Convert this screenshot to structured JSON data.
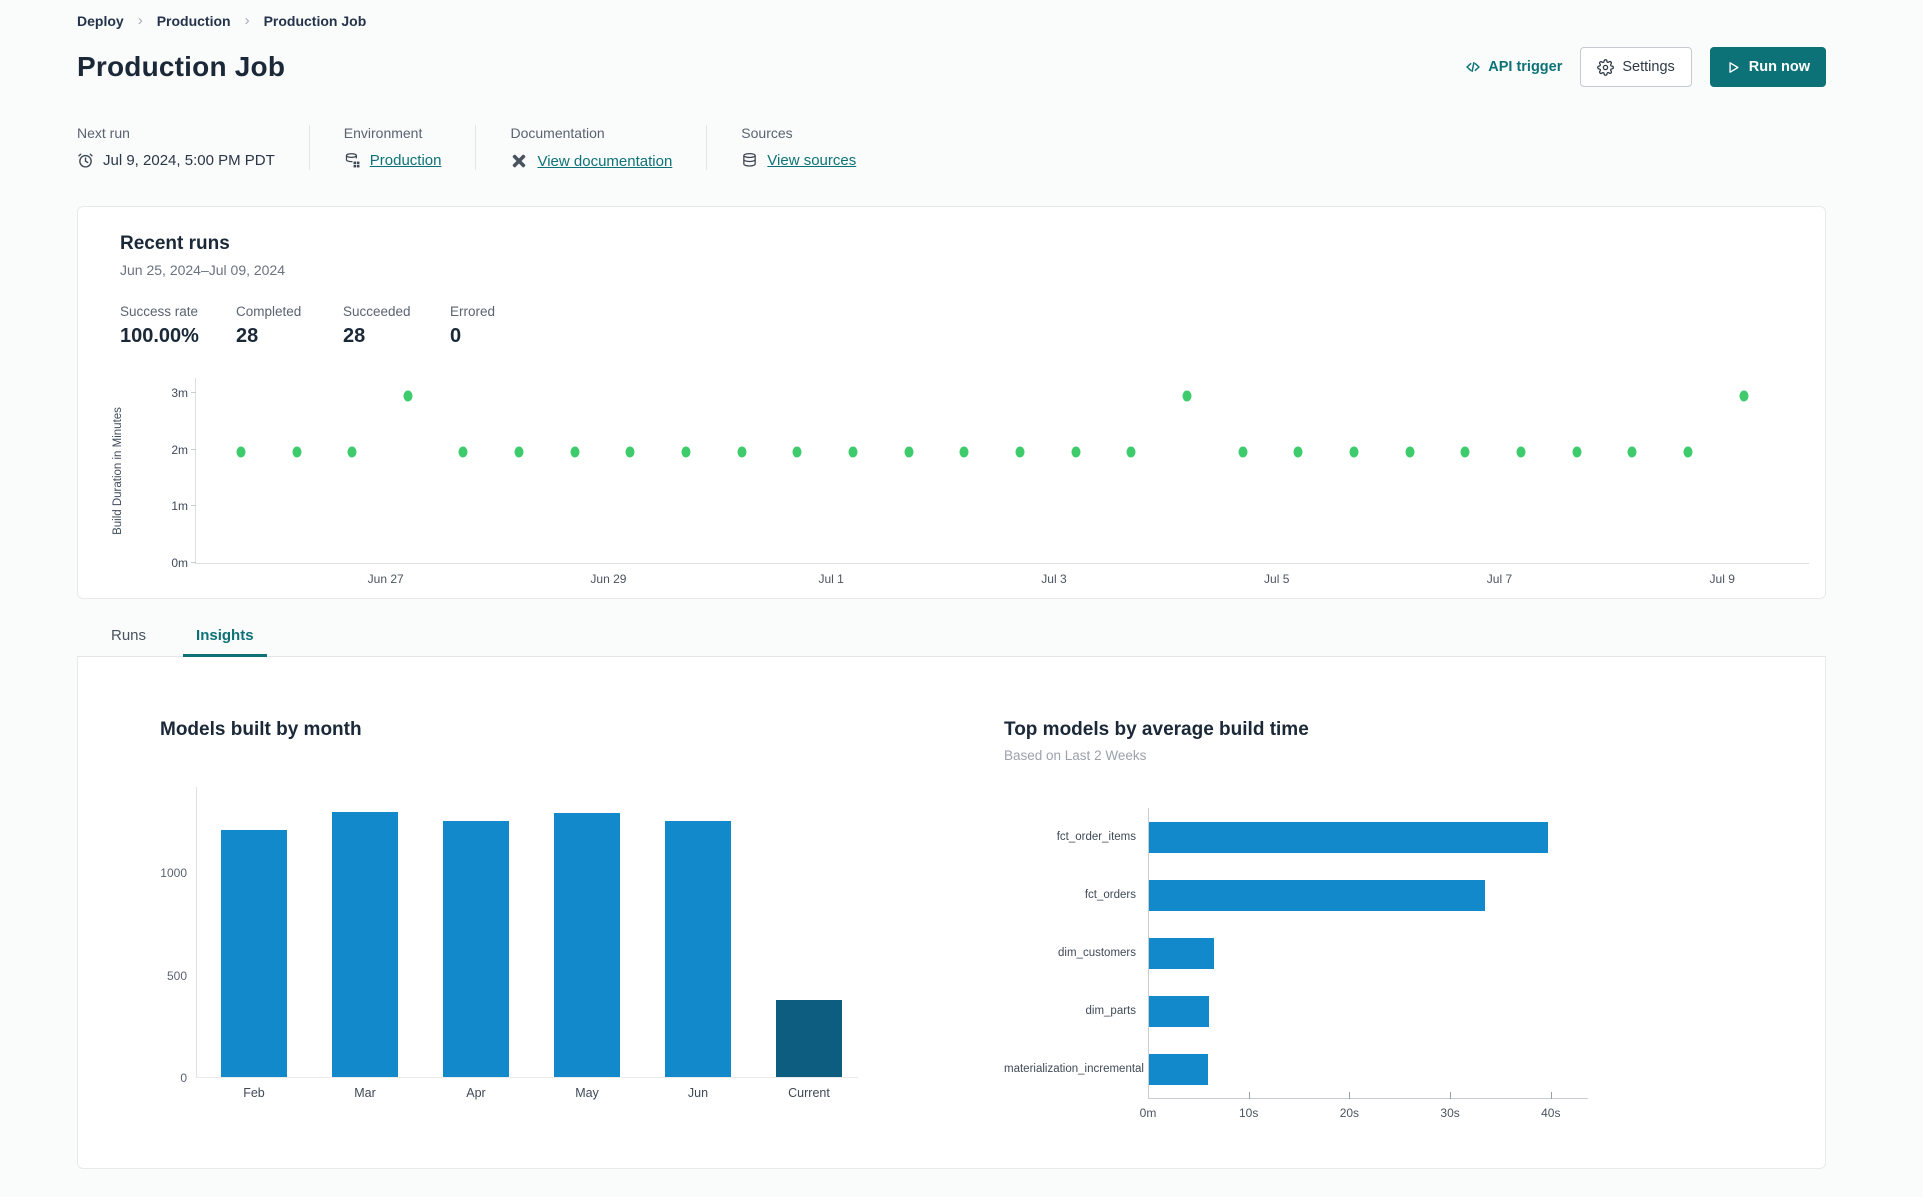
{
  "colors": {
    "accent_teal": "#0d7277",
    "success_green": "#3dcb6c",
    "bar_blue": "#1289ca",
    "bar_dark_navy": "#0c5d80",
    "page_background": "#fafbfb",
    "card_border": "#e7e9eb",
    "dark_text": "#1a2838"
  },
  "icons": {
    "breadcrumb_separator": "chevron-right-icon",
    "api_trigger": "code-icon",
    "settings": "gear-icon",
    "run_now": "play-icon",
    "next_run": "clock-icon",
    "environment": "environment-database-icon",
    "documentation": "dbt-docs-icon",
    "sources": "database-icon"
  },
  "breadcrumb": {
    "items": [
      "Deploy",
      "Production",
      "Production Job"
    ]
  },
  "header": {
    "title": "Production Job",
    "api_trigger_label": "API trigger",
    "settings_label": "Settings",
    "run_now_label": "Run now"
  },
  "meta": {
    "columns": [
      {
        "label": "Next run",
        "value": "Jul 9, 2024, 5:00 PM PDT",
        "is_link": false
      },
      {
        "label": "Environment",
        "value": "Production",
        "is_link": true
      },
      {
        "label": "Documentation",
        "value": "View documentation",
        "is_link": true
      },
      {
        "label": "Sources",
        "value": "View sources",
        "is_link": true
      }
    ]
  },
  "recent_runs": {
    "title": "Recent runs",
    "date_range": "Jun 25, 2024–Jul 09, 2024",
    "stats": [
      {
        "label": "Success rate",
        "value": "100.00%"
      },
      {
        "label": "Completed",
        "value": "28"
      },
      {
        "label": "Succeeded",
        "value": "28"
      },
      {
        "label": "Errored",
        "value": "0"
      }
    ]
  },
  "tabs": [
    {
      "label": "Runs",
      "active": false
    },
    {
      "label": "Insights",
      "active": true
    }
  ],
  "chart_data": [
    {
      "type": "scatter",
      "ylabel": "Build Duration in Minutes",
      "ylim": [
        0,
        3.26
      ],
      "y_ticks": [
        {
          "label": "0m",
          "value": 0
        },
        {
          "label": "1m",
          "value": 1
        },
        {
          "label": "2m",
          "value": 2
        },
        {
          "label": "3m",
          "value": 3
        }
      ],
      "x_tick_labels": [
        "Jun 27",
        "Jun 29",
        "Jul 1",
        "Jul 3",
        "Jul 5",
        "Jul 7",
        "Jul 9"
      ],
      "point_color": "#3dcb6c",
      "points_build_minutes": [
        1.95,
        1.95,
        1.95,
        2.95,
        1.95,
        1.95,
        1.95,
        1.95,
        1.95,
        1.95,
        1.95,
        1.95,
        1.95,
        1.95,
        1.95,
        1.95,
        1.95,
        2.95,
        1.95,
        1.95,
        1.95,
        1.95,
        1.95,
        1.95,
        1.95,
        1.95,
        1.95,
        2.95
      ]
    },
    {
      "type": "bar",
      "title": "Models built by month",
      "categories": [
        "Feb",
        "Mar",
        "Apr",
        "May",
        "Jun",
        "Current"
      ],
      "values": [
        1210,
        1300,
        1255,
        1295,
        1255,
        375
      ],
      "bar_colors": [
        "#1289ca",
        "#1289ca",
        "#1289ca",
        "#1289ca",
        "#1289ca",
        "#0c5d80"
      ],
      "y_ticks": [
        0,
        500,
        1000
      ],
      "ylim": [
        0,
        1420
      ],
      "grid": false,
      "ylabel": "",
      "xlabel": ""
    },
    {
      "type": "bar-horizontal",
      "title": "Top models by average build time",
      "subtitle": "Based on Last 2 Weeks",
      "categories": [
        "fct_order_items",
        "fct_orders",
        "dim_customers",
        "dim_parts",
        "materialization_incremental"
      ],
      "values_seconds": [
        39.7,
        33.5,
        6.6,
        6.1,
        6.0
      ],
      "x_ticks": [
        {
          "label": "0m",
          "value": 0
        },
        {
          "label": "10s",
          "value": 10
        },
        {
          "label": "20s",
          "value": 20
        },
        {
          "label": "30s",
          "value": 30
        },
        {
          "label": "40s",
          "value": 40
        }
      ],
      "xlim": [
        0,
        43
      ],
      "bar_color": "#1289ca",
      "grid": false
    }
  ]
}
